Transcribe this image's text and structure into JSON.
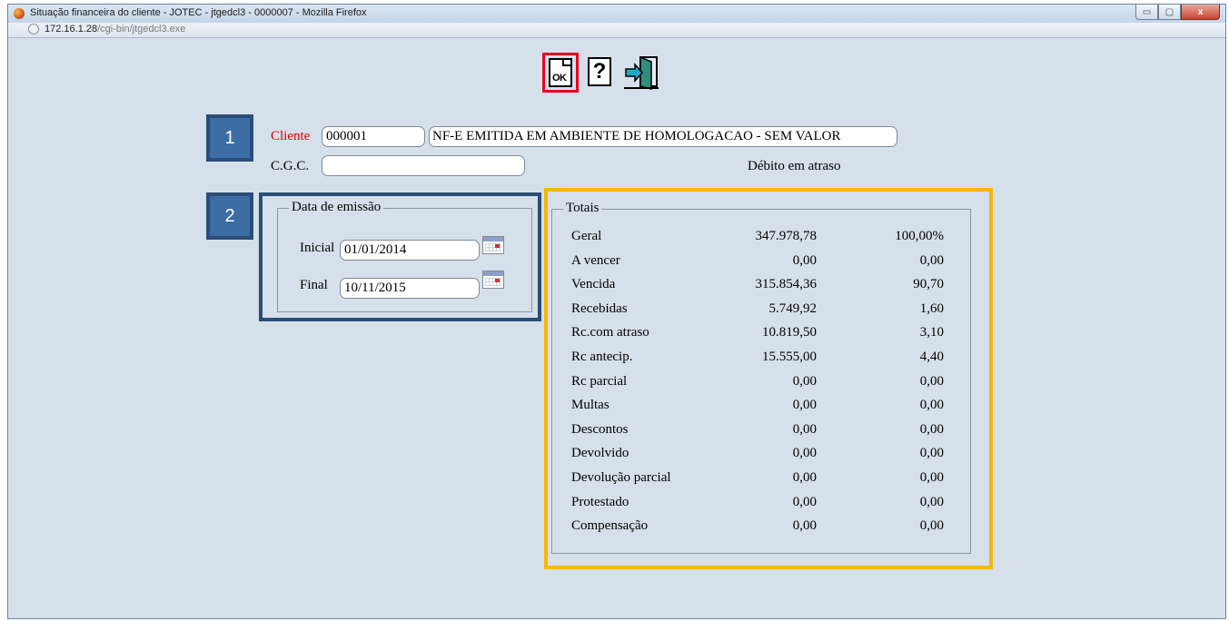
{
  "window": {
    "title": "Situação financeira do cliente - JOTEC - jtgedcl3 - 0000007 - Mozilla Firefox",
    "url_host": "172.16.1.28",
    "url_path": "/cgi-bin/jtgedcl3.exe",
    "controls": {
      "minimize": "▭",
      "maximize": "▢",
      "close": "x"
    }
  },
  "toolbar": {
    "ok_label": "OK",
    "help_label": "?",
    "ok_icon": "ok-document-icon",
    "help_icon": "help-icon",
    "exit_icon": "exit-door-icon"
  },
  "badges": {
    "one": "1",
    "two": "2"
  },
  "cliente": {
    "label": "Cliente",
    "code": "000001",
    "name": "NF-E EMITIDA EM AMBIENTE DE HOMOLOGACAO - SEM VALOR",
    "cgc_label": "C.G.C.",
    "cgc_value": "",
    "debito_label": "Débito em atraso"
  },
  "emissao": {
    "title": "Data de emissão",
    "inicial_label": "Inicial",
    "inicial_value": "01/01/2014",
    "final_label": "Final",
    "final_value": "10/11/2015"
  },
  "totais": {
    "title": "Totais",
    "rows": [
      {
        "label": "Geral",
        "value": "347.978,78",
        "pct": "100,00%"
      },
      {
        "label": "A vencer",
        "value": "0,00",
        "pct": "0,00"
      },
      {
        "label": "Vencida",
        "value": "315.854,36",
        "pct": "90,70"
      },
      {
        "label": "Recebidas",
        "value": "5.749,92",
        "pct": "1,60"
      },
      {
        "label": "Rc.com atraso",
        "value": "10.819,50",
        "pct": "3,10"
      },
      {
        "label": "Rc antecip.",
        "value": "15.555,00",
        "pct": "4,40"
      },
      {
        "label": "Rc parcial",
        "value": "0,00",
        "pct": "0,00"
      },
      {
        "label": "Multas",
        "value": "0,00",
        "pct": "0,00"
      },
      {
        "label": "Descontos",
        "value": "0,00",
        "pct": "0,00"
      },
      {
        "label": "Devolvido",
        "value": "0,00",
        "pct": "0,00"
      },
      {
        "label": "Devolução parcial",
        "value": "0,00",
        "pct": "0,00"
      },
      {
        "label": "Protestado",
        "value": "0,00",
        "pct": "0,00"
      },
      {
        "label": "Compensação",
        "value": "0,00",
        "pct": "0,00"
      }
    ]
  },
  "colors": {
    "highlight_ok": "#e8001c",
    "highlight_blue": "#2b4e78",
    "highlight_gold": "#f4b800",
    "badge": "#3c6ea5"
  }
}
